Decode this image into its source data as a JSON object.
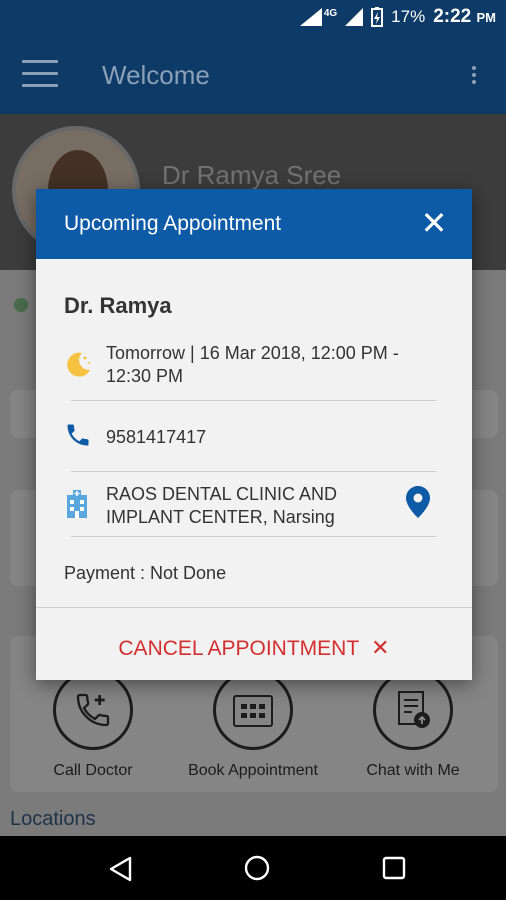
{
  "status_bar": {
    "network": "4G",
    "battery": "17%",
    "time": "2:22",
    "ampm": "PM"
  },
  "app_bar": {
    "title": "Welcome"
  },
  "profile": {
    "name": "Dr Ramya Sree"
  },
  "background": {
    "quick_actions": [
      {
        "label": "Call Doctor",
        "icon": "phone-plus-icon"
      },
      {
        "label": "Book Appointment",
        "icon": "calendar-icon"
      },
      {
        "label": "Chat with Me",
        "icon": "chat-icon"
      }
    ],
    "locations_label": "Locations"
  },
  "dialog": {
    "title": "Upcoming Appointment",
    "doctor": "Dr. Ramya",
    "datetime_line1": "Tomorrow | 16 Mar 2018, 12:00 PM -",
    "datetime_line2": "12:30 PM",
    "phone": "9581417417",
    "location_line1": "RAOS DENTAL CLINIC AND",
    "location_line2": "IMPLANT CENTER, Narsing",
    "payment": "Payment : Not Done",
    "cancel_label": "CANCEL APPOINTMENT"
  },
  "colors": {
    "primary": "#0d3a66",
    "dialog_header": "#0d5aa7",
    "cancel": "#d32f2f",
    "moon": "#f5c242",
    "icon_blue": "#0d5aa7"
  }
}
